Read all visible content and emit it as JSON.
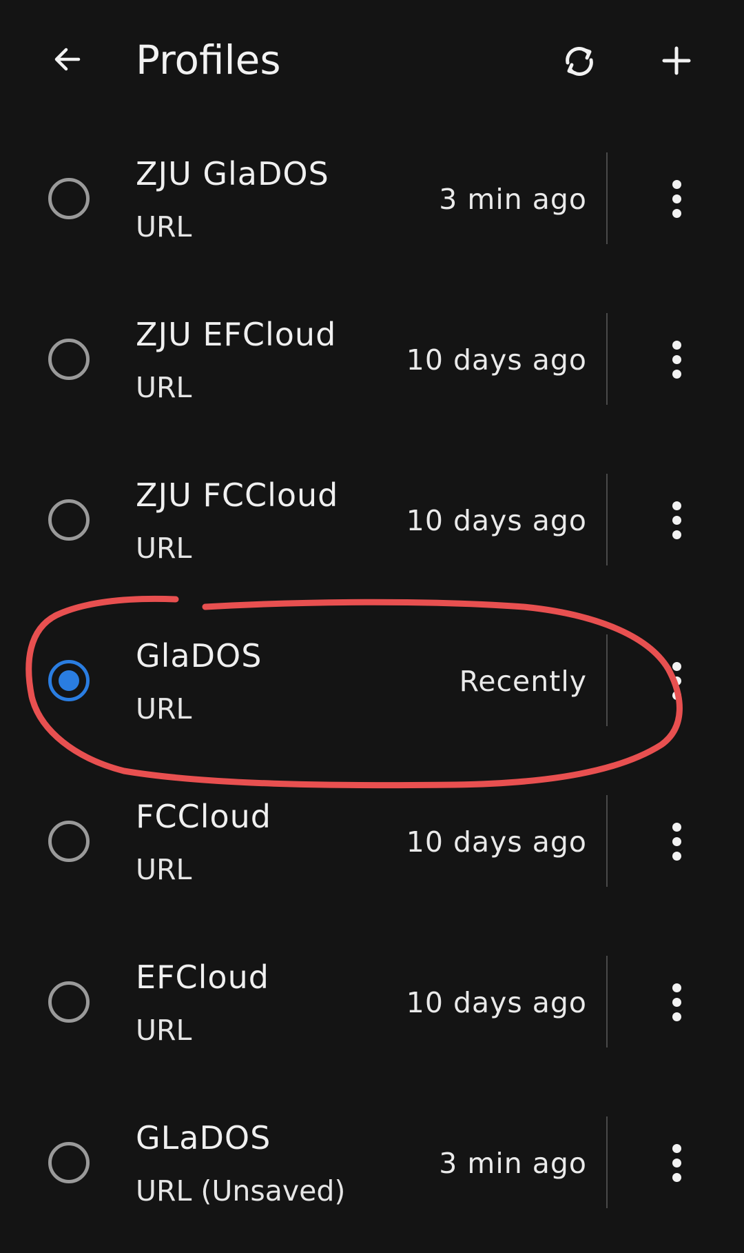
{
  "header": {
    "title": "Profiles",
    "back_icon": "arrow-left-icon",
    "sync_icon": "sync-icon",
    "add_icon": "plus-icon"
  },
  "profiles": [
    {
      "name": "ZJU GlaDOS",
      "type": "URL",
      "updated": "3 min ago",
      "selected": false
    },
    {
      "name": "ZJU EFCloud",
      "type": "URL",
      "updated": "10 days ago",
      "selected": false
    },
    {
      "name": "ZJU FCCloud",
      "type": "URL",
      "updated": "10 days ago",
      "selected": false
    },
    {
      "name": "GlaDOS",
      "type": "URL",
      "updated": "Recently",
      "selected": true
    },
    {
      "name": "FCCloud",
      "type": "URL",
      "updated": "10 days ago",
      "selected": false
    },
    {
      "name": "EFCloud",
      "type": "URL",
      "updated": "10 days ago",
      "selected": false
    },
    {
      "name": "GLaDOS",
      "type": "URL (Unsaved)",
      "updated": "3 min ago",
      "selected": false
    }
  ],
  "colors": {
    "background": "#141414",
    "selected_radio": "#2a7de1",
    "annotation": "#e85050"
  }
}
